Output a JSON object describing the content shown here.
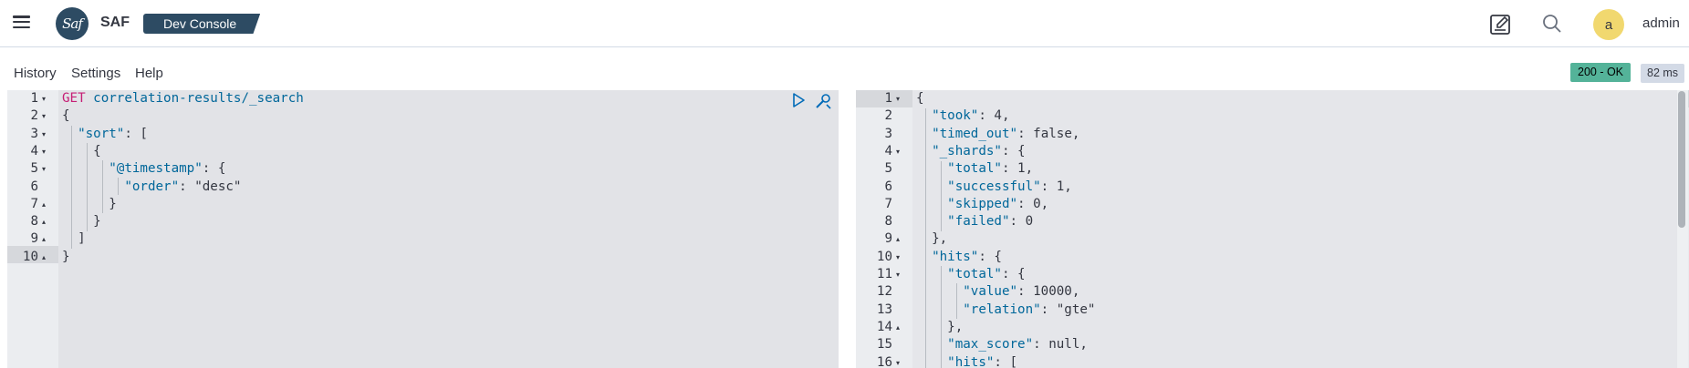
{
  "header": {
    "brand": "SAF",
    "logo_text": "Saf",
    "breadcrumb": "Dev Console",
    "avatar_letter": "a",
    "username": "admin",
    "icons": [
      "menu-icon",
      "edit-icon",
      "search-icon"
    ]
  },
  "subnav": {
    "tabs": [
      "History",
      "Settings",
      "Help"
    ],
    "status": "200 - OK",
    "time": "82 ms"
  },
  "request": {
    "method": "GET",
    "path": "correlation-results/_search",
    "lines": [
      {
        "n": "1",
        "fold": "▾",
        "text": ""
      },
      {
        "n": "2",
        "fold": "▾",
        "text": "{"
      },
      {
        "n": "3",
        "fold": "▾",
        "text": "  \"sort\": ["
      },
      {
        "n": "4",
        "fold": "▾",
        "text": "    {"
      },
      {
        "n": "5",
        "fold": "▾",
        "text": "      \"@timestamp\": {"
      },
      {
        "n": "6",
        "fold": "",
        "text": "        \"order\": \"desc\""
      },
      {
        "n": "7",
        "fold": "▴",
        "text": "      }"
      },
      {
        "n": "8",
        "fold": "▴",
        "text": "    }"
      },
      {
        "n": "9",
        "fold": "▴",
        "text": "  ]"
      },
      {
        "n": "10",
        "fold": "▴",
        "text": "}"
      }
    ]
  },
  "response": {
    "lines": [
      {
        "n": "1",
        "fold": "▾",
        "text": "{"
      },
      {
        "n": "2",
        "fold": "",
        "text": "  \"took\": 4,"
      },
      {
        "n": "3",
        "fold": "",
        "text": "  \"timed_out\": false,"
      },
      {
        "n": "4",
        "fold": "▾",
        "text": "  \"_shards\": {"
      },
      {
        "n": "5",
        "fold": "",
        "text": "    \"total\": 1,"
      },
      {
        "n": "6",
        "fold": "",
        "text": "    \"successful\": 1,"
      },
      {
        "n": "7",
        "fold": "",
        "text": "    \"skipped\": 0,"
      },
      {
        "n": "8",
        "fold": "",
        "text": "    \"failed\": 0"
      },
      {
        "n": "9",
        "fold": "▴",
        "text": "  },"
      },
      {
        "n": "10",
        "fold": "▾",
        "text": "  \"hits\": {"
      },
      {
        "n": "11",
        "fold": "▾",
        "text": "    \"total\": {"
      },
      {
        "n": "12",
        "fold": "",
        "text": "      \"value\": 10000,"
      },
      {
        "n": "13",
        "fold": "",
        "text": "      \"relation\": \"gte\""
      },
      {
        "n": "14",
        "fold": "▴",
        "text": "    },"
      },
      {
        "n": "15",
        "fold": "",
        "text": "    \"max_score\": null,"
      },
      {
        "n": "16",
        "fold": "▾",
        "text": "    \"hits\": ["
      }
    ]
  },
  "colors": {
    "brand": "#2d4b63",
    "status_ok": "#54b399",
    "avatar": "#f1d86f",
    "key": "#00679a",
    "string": "#007a00",
    "keyword": "#6b55cc",
    "method": "#c61e75"
  }
}
